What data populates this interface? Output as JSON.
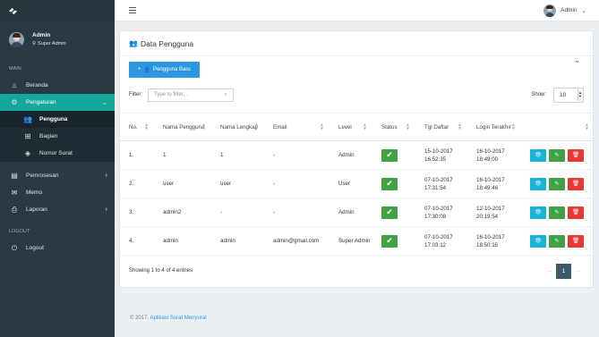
{
  "sidebar": {
    "user": {
      "name": "Admin",
      "role": "Super Admin"
    },
    "section_main": "MAIN",
    "items": [
      {
        "label": "Beranda",
        "icon": "home-icon"
      },
      {
        "label": "Pengaturan",
        "icon": "gear-icon",
        "active": true
      },
      {
        "label": "Pemrosesan",
        "icon": "document-icon"
      },
      {
        "label": "Memo",
        "icon": "mail-icon"
      },
      {
        "label": "Laporan",
        "icon": "printer-icon"
      }
    ],
    "submenu": [
      {
        "label": "Pengguna",
        "icon": "users-icon"
      },
      {
        "label": "Bagian",
        "icon": "sitemap-icon"
      },
      {
        "label": "Nomor Surat",
        "icon": "cube-icon"
      }
    ],
    "section_logout": "LOGOUT",
    "logout_label": "Logout"
  },
  "topbar": {
    "user_name": "Admin"
  },
  "card": {
    "title": "Data Pengguna",
    "new_button": "Pengguna Baru",
    "filter_label": "Filter:",
    "filter_placeholder": "Type to filter...",
    "show_label": "Show:",
    "show_value": "10",
    "columns": [
      "No.",
      "Nama Pengguna",
      "Nama Lengkap",
      "Email",
      "Level",
      "Status",
      "Tgl Daftar",
      "Login Terakhir",
      ""
    ],
    "rows": [
      {
        "no": "1.",
        "username": "1",
        "fullname": "1",
        "email": "-",
        "level": "Admin",
        "registered": "15-10-2017 16:52:35",
        "last_login": "16-10-2017 18:49:00"
      },
      {
        "no": "2.",
        "username": "user",
        "fullname": "user",
        "email": "-",
        "level": "User",
        "registered": "07-10-2017 17:31:54",
        "last_login": "16-10-2017 18:49:46"
      },
      {
        "no": "3.",
        "username": "admin2",
        "fullname": "-",
        "email": "-",
        "level": "Admin",
        "registered": "07-10-2017 17:30:08",
        "last_login": "12-10-2017 20:19:54"
      },
      {
        "no": "4.",
        "username": "admin",
        "fullname": "admin",
        "email": "admin@gmail.com",
        "level": "Super Admin",
        "registered": "07-10-2017 17:03:12",
        "last_login": "16-10-2017 18:50:15"
      }
    ],
    "info": "Showing 1 to 4 of 4 entries",
    "pagination": {
      "prev": "←",
      "page": "1",
      "next": "→"
    }
  },
  "footer": {
    "prefix": "© 2017.",
    "link": "Aplikasi Surat Menyurat"
  }
}
